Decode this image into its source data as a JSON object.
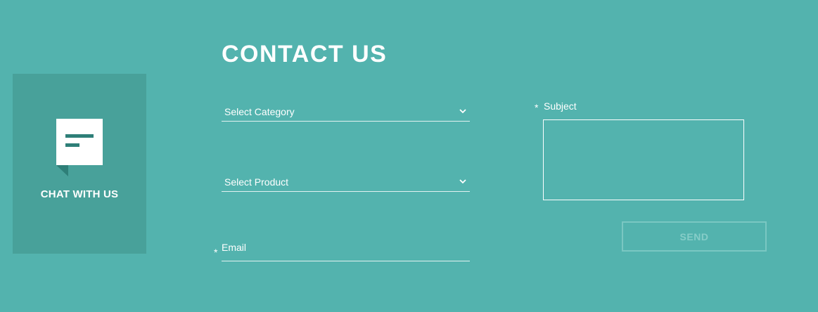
{
  "page": {
    "title": "CONTACT US"
  },
  "chat": {
    "label": "CHAT WITH US",
    "icon": "chat-bubble-icon"
  },
  "form": {
    "category": {
      "value": "Select Category",
      "icon": "chevron-down-icon"
    },
    "product": {
      "value": "Select Product",
      "icon": "chevron-down-icon"
    },
    "email": {
      "placeholder": "Email",
      "value": "",
      "required_marker": "*"
    },
    "subject": {
      "label": "Subject",
      "value": "",
      "required_marker": "*"
    },
    "send_label": "SEND"
  },
  "colors": {
    "background": "#53b3ae",
    "chat_card": "#48a19a",
    "icon_accent": "#2e7f78",
    "text": "#ffffff",
    "send_button": "#86cdc8"
  }
}
